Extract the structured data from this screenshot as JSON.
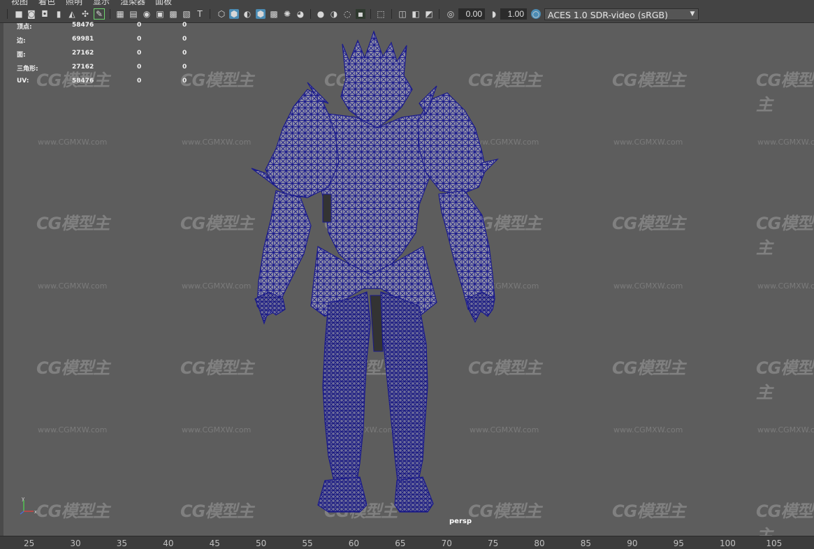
{
  "menu": [
    "视图",
    "着色",
    "照明",
    "显示",
    "渲染器",
    "面板"
  ],
  "toolbar": {
    "exposure_value": "0.00",
    "gamma_value": "1.00",
    "color_management": "ACES 1.0 SDR-video (sRGB)"
  },
  "hud": {
    "rows": [
      {
        "label": "顶点:",
        "v1": "58476",
        "v2": "0",
        "v3": "0"
      },
      {
        "label": "边:",
        "v1": "69981",
        "v2": "0",
        "v3": "0"
      },
      {
        "label": "面:",
        "v1": "27162",
        "v2": "0",
        "v3": "0"
      },
      {
        "label": "三角形:",
        "v1": "27162",
        "v2": "0",
        "v3": "0"
      },
      {
        "label": "UV:",
        "v1": "58476",
        "v2": "0",
        "v3": "0"
      }
    ]
  },
  "camera_label": "persp",
  "watermark": {
    "text": "CG模型主",
    "url": "www.CGMXW.com"
  },
  "timeline_ticks": [
    "25",
    "30",
    "35",
    "40",
    "45",
    "50",
    "55",
    "60",
    "65",
    "70",
    "75",
    "80",
    "85",
    "90",
    "95",
    "100",
    "105"
  ],
  "colors": {
    "viewport_bg": "#5d5d5d",
    "wireframe": "#1a1a8c",
    "accent": "#4b8cb4"
  }
}
